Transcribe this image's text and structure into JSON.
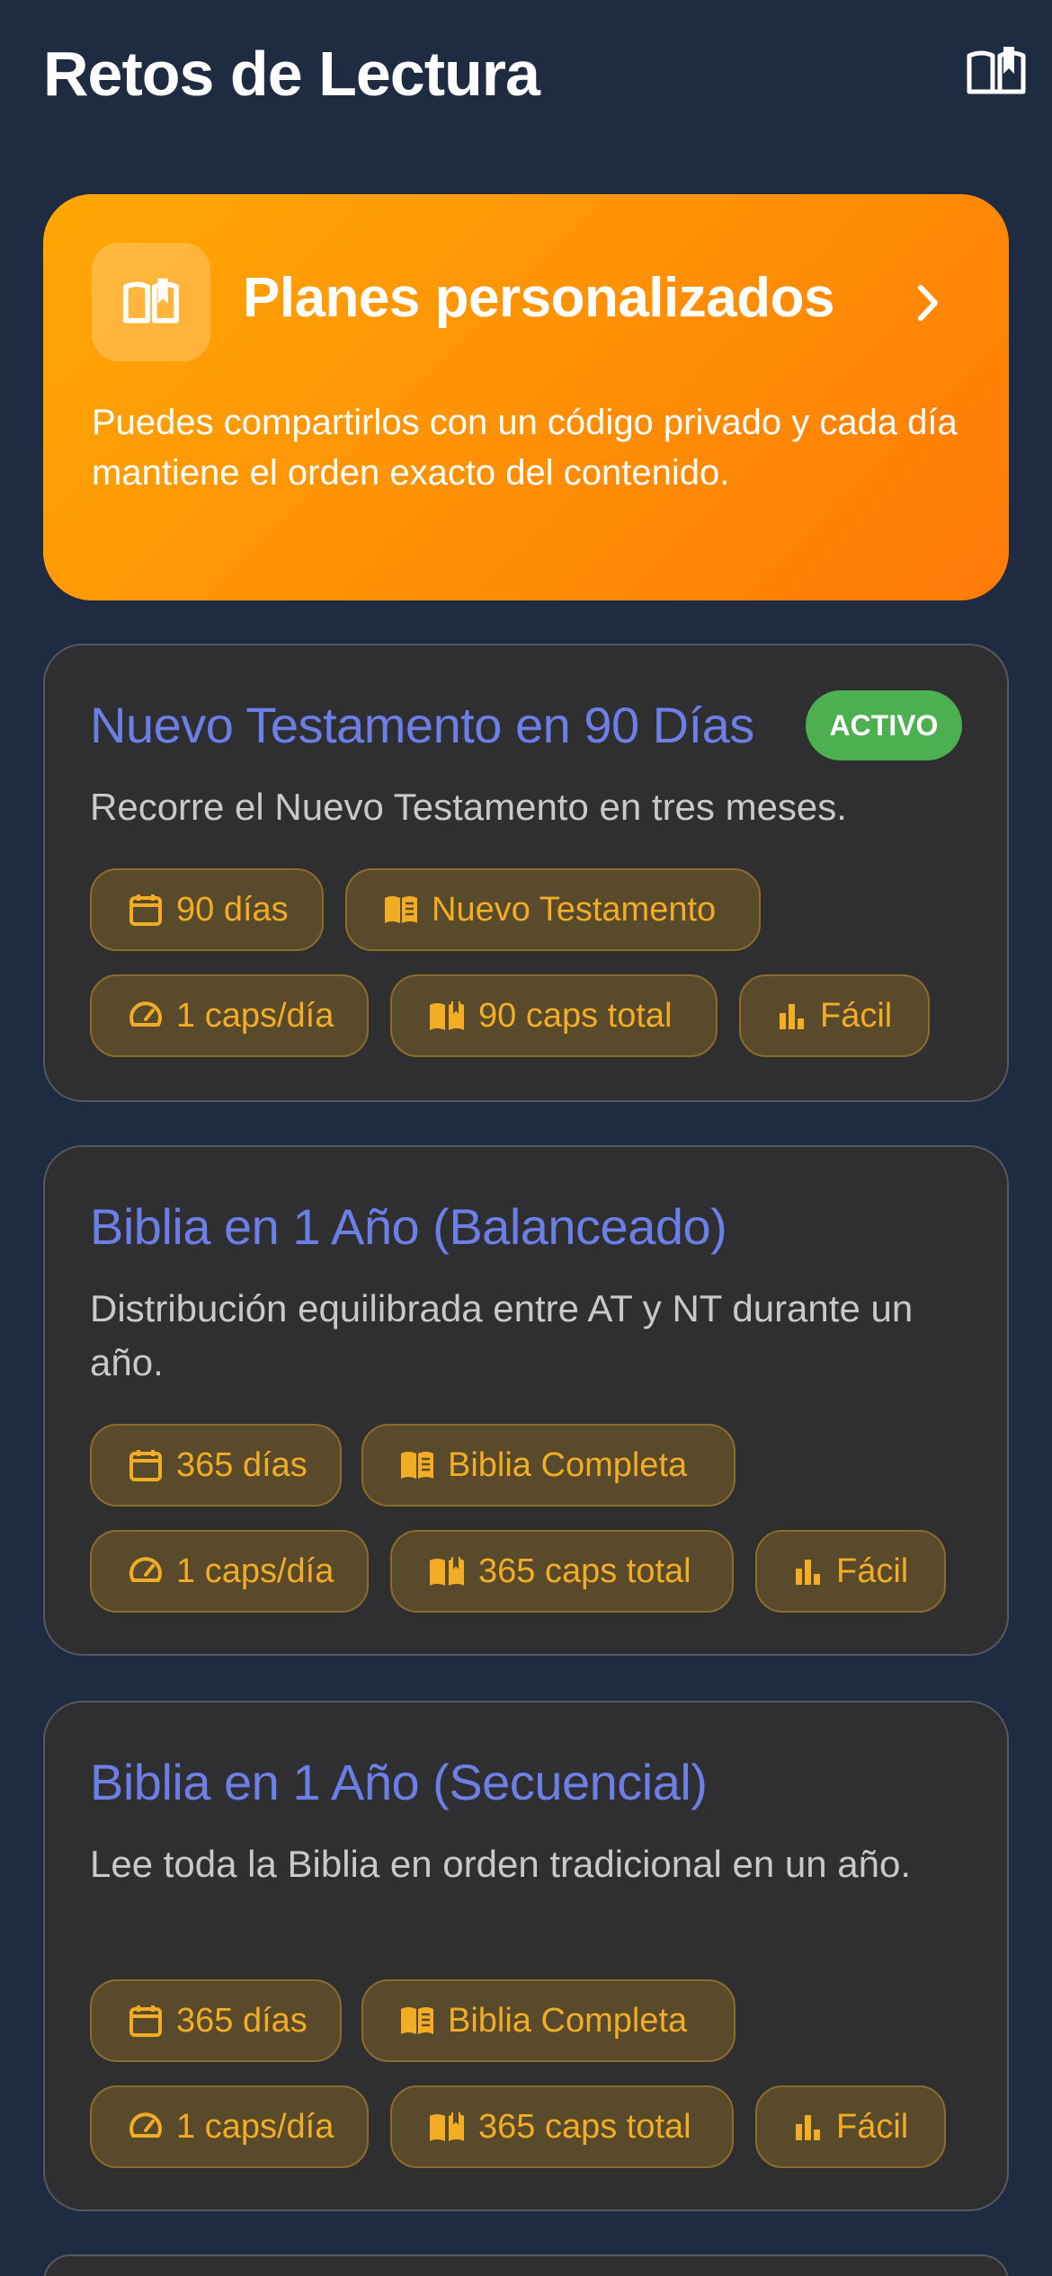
{
  "header": {
    "title": "Retos de Lectura",
    "icon": "book-open-icon"
  },
  "promo": {
    "title": "Planes personalizados",
    "description": "Puedes compartirlos con un código privado y cada día mantiene el orden exacto del contenido.",
    "icon": "book-open-icon",
    "colors": {
      "gradient_start": "#ffa805",
      "gradient_end": "#ff7a08"
    }
  },
  "plans": [
    {
      "title": "Nuevo Testamento en 90 Días",
      "badge": "ACTIVO",
      "description": "Recorre el Nuevo Testamento en tres meses.",
      "duration": "90 días",
      "scope": "Nuevo Testamento",
      "pace": "1 caps/día",
      "total": "90 caps total",
      "difficulty": "Fácil"
    },
    {
      "title": "Biblia en 1 Año (Balanceado)",
      "description": "Distribución equilibrada entre AT y NT durante un año.",
      "duration": "365 días",
      "scope": "Biblia Completa",
      "pace": "1 caps/día",
      "total": "365 caps total",
      "difficulty": "Fácil"
    },
    {
      "title": "Biblia en 1 Año (Secuencial)",
      "description": "Lee toda la Biblia en orden tradicional en un año.",
      "duration": "365 días",
      "scope": "Biblia Completa",
      "pace": "1 caps/día",
      "total": "365 caps total",
      "difficulty": "Fácil"
    }
  ],
  "colors": {
    "background": "#1f2b40",
    "card": "#2f2f31",
    "title_accent": "#6d7fe6",
    "chip_text": "#f2ad24",
    "badge": "#4caf50"
  }
}
